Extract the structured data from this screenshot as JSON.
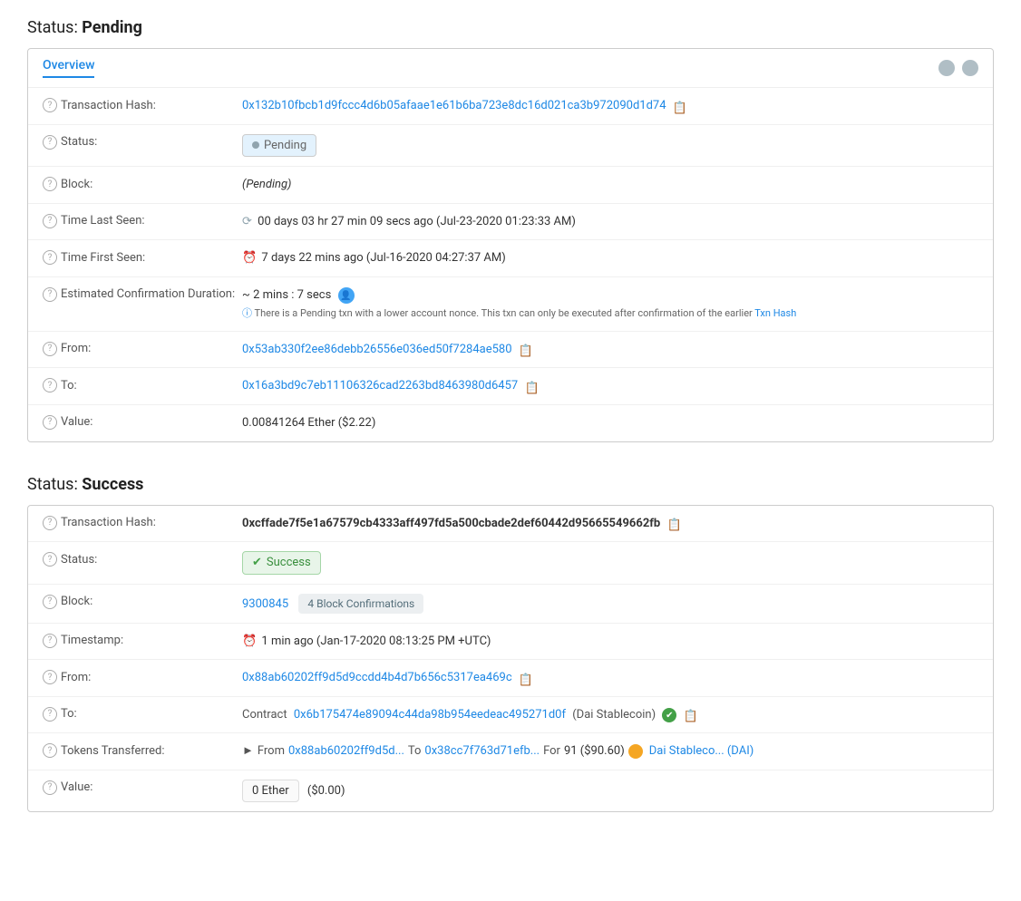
{
  "pending": {
    "sectionTitle": "Status:",
    "sectionStatus": "Pending",
    "tab": "Overview",
    "fields": {
      "txHash": {
        "label": "Transaction Hash:",
        "value": "0x132b10fbcb1d9fccc4d6b05afaae1e61b6ba723e8dc16d021ca3b972090d1d74"
      },
      "status": {
        "label": "Status:",
        "badge": "Pending"
      },
      "block": {
        "label": "Block:",
        "value": "(Pending)"
      },
      "timeLastSeen": {
        "label": "Time Last Seen:",
        "value": "00 days 03 hr 27 min 09 secs ago (Jul-23-2020 01:23:33 AM)"
      },
      "timeFirstSeen": {
        "label": "Time First Seen:",
        "value": "7 days 22 mins ago (Jul-16-2020 04:27:37 AM)"
      },
      "estimatedConfirmation": {
        "label": "Estimated Confirmation Duration:",
        "value": "~ 2 mins : 7 secs",
        "note": "There is a Pending txn with a lower account nonce. This txn can only be executed after confirmation of the earlier",
        "noteLink": "Txn Hash"
      },
      "from": {
        "label": "From:",
        "value": "0x53ab330f2ee86debb26556e036ed50f7284ae580"
      },
      "to": {
        "label": "To:",
        "value": "0x16a3bd9c7eb11106326cad2263bd8463980d6457"
      },
      "value": {
        "label": "Value:",
        "value": "0.00841264 Ether ($2.22)"
      }
    }
  },
  "success": {
    "sectionTitle": "Status:",
    "sectionStatus": "Success",
    "fields": {
      "txHash": {
        "label": "Transaction Hash:",
        "value": "0xcffade7f5e1a67579cb4333aff497fd5a500cbade2def60442d95665549662fb"
      },
      "status": {
        "label": "Status:",
        "badge": "Success"
      },
      "block": {
        "label": "Block:",
        "blockNumber": "9300845",
        "confirmations": "4 Block Confirmations"
      },
      "timestamp": {
        "label": "Timestamp:",
        "value": "1 min ago (Jan-17-2020 08:13:25 PM +UTC)"
      },
      "from": {
        "label": "From:",
        "value": "0x88ab60202ff9d5d9ccdd4b4d7b656c5317ea469c"
      },
      "to": {
        "label": "To:",
        "contractLabel": "Contract",
        "contractAddress": "0x6b175474e89094c44da98b954eedeac495271d0f",
        "contractName": "(Dai Stablecoin)"
      },
      "tokensTransferred": {
        "label": "Tokens Transferred:",
        "fromAddress": "0x88ab60202ff9d5d...",
        "toAddress": "0x38cc7f763d71efb...",
        "amount": "91 ($90.60)",
        "tokenName": "Dai Stableco... (DAI)"
      },
      "value": {
        "label": "Value:",
        "boxValue": "0 Ether",
        "usdValue": "($0.00)"
      }
    }
  }
}
